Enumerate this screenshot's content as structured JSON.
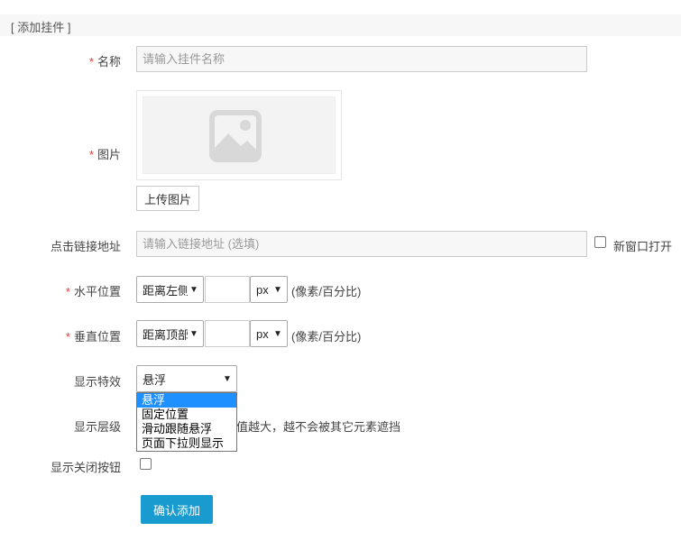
{
  "header": {
    "title": "[ 添加挂件 ]"
  },
  "form": {
    "name": {
      "label": "名称",
      "required_mark": "*",
      "placeholder": "请输入挂件名称",
      "value": ""
    },
    "image": {
      "label": "图片",
      "required_mark": "*",
      "upload_label": "上传图片",
      "preview_icon": "image-placeholder-icon"
    },
    "link": {
      "label": "点击链接地址",
      "placeholder": "请输入链接地址 (选填)",
      "value": "",
      "new_window_label": "新窗口打开",
      "new_window_checked": false
    },
    "horizontal": {
      "label": "水平位置",
      "required_mark": "*",
      "direction": "距离左侧",
      "value": "",
      "unit": "px",
      "hint": "(像素/百分比)"
    },
    "vertical": {
      "label": "垂直位置",
      "required_mark": "*",
      "direction": "距离顶部",
      "value": "",
      "unit": "px",
      "hint": "(像素/百分比)"
    },
    "effect": {
      "label": "显示特效",
      "selected": "悬浮",
      "options": [
        "悬浮",
        "固定位置",
        "滑动跟随悬浮",
        "页面下拉则显示"
      ],
      "highlighted_index": 0
    },
    "level": {
      "label": "显示层级",
      "hint_visible": "值越大，越不会被其它元素遮挡"
    },
    "close_button": {
      "label": "显示关闭按钮",
      "checked": false
    },
    "submit_label": "确认添加"
  },
  "colors": {
    "primary": "#1a9bd0",
    "required": "#e33333",
    "highlight": "#1e90ff"
  }
}
